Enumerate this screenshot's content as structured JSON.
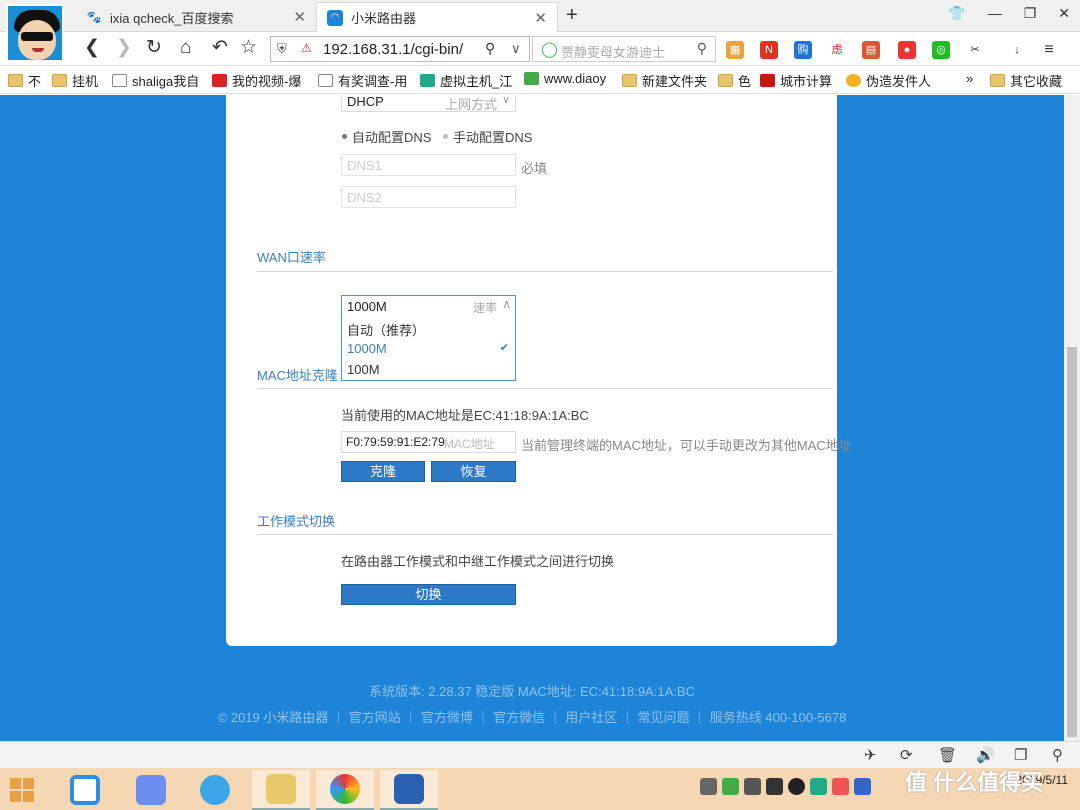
{
  "browser": {
    "tabs": [
      {
        "title": "ixia qcheck_百度搜索",
        "icon": "baidu-paw-icon"
      },
      {
        "title": "小米路由器",
        "icon": "wifi-icon"
      }
    ],
    "url": "192.168.31.1/cgi-bin/",
    "search_placeholder": "贾静雯母女游迪士",
    "bookmarks": [
      "不",
      "挂机",
      "shaliga我自",
      "我的视频-爆",
      "有奖调查-用",
      "虚拟主机_江",
      "www.diaoy",
      "新建文件夹",
      "色",
      "城市计算",
      "伪造发件人",
      "»",
      "其它收藏"
    ]
  },
  "router": {
    "connection_type": {
      "value": "DHCP",
      "hint": "上网方式"
    },
    "dns_auto_label": "自动配置DNS",
    "dns_manual_label": "手动配置DNS",
    "dns1_placeholder": "DNS1",
    "dns1_required": "必填",
    "dns2_placeholder": "DNS2",
    "wan_speed": {
      "title": "WAN口速率",
      "current": "1000M",
      "hint": "速率",
      "options": [
        "自动（推荐）",
        "1000M",
        "100M"
      ],
      "selected_index": 1
    },
    "mac_clone": {
      "title": "MAC地址克隆",
      "current_text": "当前使用的MAC地址是EC:41:18:9A:1A:BC",
      "input_value": "F0:79:59:91:E2:79",
      "input_placeholder": "MAC地址",
      "note": "当前管理终端的MAC地址，可以手动更改为其他MAC地址",
      "clone_button": "克隆",
      "restore_button": "恢复"
    },
    "work_mode": {
      "title": "工作模式切换",
      "description": "在路由器工作模式和中继工作模式之间进行切换",
      "switch_button": "切换"
    },
    "footer": {
      "version_line": "系统版本: 2.28.37 稳定版  MAC地址: EC:41:18:9A:1A:BC",
      "links_line": "© 2019 小米路由器 ｜ 官方网站 ｜ 官方微博 ｜ 官方微信 ｜ 用户社区 ｜ 常见问题 ｜ 服务热线 400-100-5678"
    }
  },
  "taskbar": {
    "clock": "2019/5/11",
    "apps": [
      "baidu-netdisk-icon",
      "feishu-icon",
      "browser-icon",
      "file-explorer-icon",
      "chrome-icon",
      "word-icon"
    ],
    "watermark": "值 什么值得买"
  },
  "colors": {
    "page_bg": "#1e84d8",
    "accent": "#2e79c7",
    "section_title": "#3a7fc1"
  }
}
